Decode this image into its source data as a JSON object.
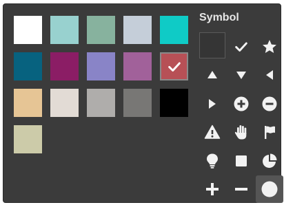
{
  "symbol_panel": {
    "title": "Symbol"
  },
  "colors": {
    "swatches": [
      "#ffffff",
      "#98d1cf",
      "#87b29e",
      "#c5ced9",
      "#0fcbc6",
      "#07627f",
      "#8b1d65",
      "#8984c7",
      "#a1619a",
      "#b75056",
      "#e6c595",
      "#e2dbd5",
      "#afadab",
      "#787775",
      "#000000",
      "#cccba9"
    ],
    "selected_swatch": "#b75056",
    "icon_color": "#f2f2f2"
  },
  "symbols": [
    "no-symbol",
    "check",
    "star",
    "triangle-up",
    "triangle-down",
    "triangle-left",
    "triangle-right",
    "plus-circle",
    "minus-circle",
    "warning",
    "hand",
    "flag",
    "lightbulb",
    "square",
    "pie",
    "plus",
    "minus",
    "circle"
  ],
  "selected_symbol": "circle"
}
